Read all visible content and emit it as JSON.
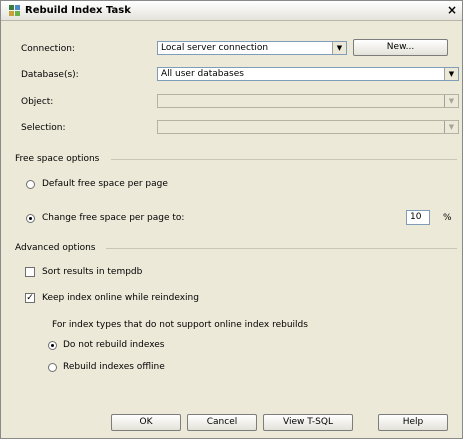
{
  "window": {
    "title": "Rebuild Index Task",
    "close_glyph": "×"
  },
  "connection": {
    "label": "Connection:",
    "value": "Local server connection",
    "new_button": "New..."
  },
  "databases": {
    "label": "Database(s):",
    "value": "All user databases"
  },
  "object": {
    "label": "Object:",
    "value": ""
  },
  "selection": {
    "label": "Selection:",
    "value": ""
  },
  "free_space": {
    "section": "Free space options",
    "default_label": "Default free space per page",
    "change_label": "Change free space per page to:",
    "change_value": "10",
    "unit": "%",
    "selected": "change"
  },
  "advanced": {
    "section": "Advanced options",
    "sort_tempdb": {
      "label": "Sort results in tempdb",
      "checked": false
    },
    "keep_online": {
      "label": "Keep index online while reindexing",
      "checked": true
    },
    "note": "For index types that do not support online index rebuilds",
    "do_not_rebuild": "Do not rebuild indexes",
    "rebuild_offline": "Rebuild indexes offline",
    "selected": "do_not_rebuild"
  },
  "buttons": {
    "ok": "OK",
    "cancel": "Cancel",
    "view_tsql": "View T-SQL",
    "help": "Help"
  },
  "glyphs": {
    "combo_arrow": "▼",
    "checkmark": "✓"
  }
}
